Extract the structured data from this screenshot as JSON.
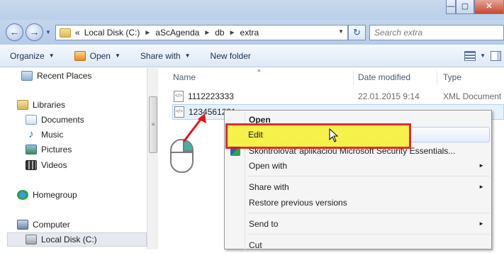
{
  "window": {
    "controls": {
      "minimize": "—",
      "maximize": "▢",
      "close": "✕"
    }
  },
  "address": {
    "back_icon": "←",
    "forward_icon": "→",
    "chevron": "«",
    "crumbs": [
      "Local Disk (C:)",
      "aScAgenda",
      "db",
      "extra"
    ],
    "search_placeholder": "Search extra",
    "refresh_icon": "↻"
  },
  "toolbar": {
    "organize": "Organize",
    "open": "Open",
    "share_with": "Share with",
    "new_folder": "New folder"
  },
  "navpane": {
    "items": [
      {
        "label": "Recent Places",
        "icon": "recent-places-icon"
      },
      {
        "label": "Libraries",
        "icon": "libraries-icon"
      },
      {
        "label": "Documents",
        "icon": "documents-icon"
      },
      {
        "label": "Music",
        "icon": "music-icon"
      },
      {
        "label": "Pictures",
        "icon": "pictures-icon"
      },
      {
        "label": "Videos",
        "icon": "videos-icon"
      },
      {
        "label": "Homegroup",
        "icon": "homegroup-icon"
      },
      {
        "label": "Computer",
        "icon": "computer-icon"
      },
      {
        "label": "Local Disk (C:)",
        "icon": "local-disk-icon"
      }
    ]
  },
  "filelist": {
    "columns": {
      "name": "Name",
      "date": "Date modified",
      "type": "Type"
    },
    "rows": [
      {
        "name": "1112223333",
        "date": "22.01.2015 9:14",
        "type": "XML Document"
      },
      {
        "name": "1234561231",
        "date": "",
        "type": ""
      }
    ]
  },
  "context_menu": {
    "items": [
      {
        "label": "Open",
        "bold": true
      },
      {
        "label": "Edit"
      },
      {
        "label": "Skontrolovať aplikáciou Microsoft Security Essentials..."
      },
      {
        "label": "Open with",
        "submenu": true
      },
      {
        "label": "Share with",
        "submenu": true
      },
      {
        "label": "Restore previous versions"
      },
      {
        "label": "Send to",
        "submenu": true
      },
      {
        "label": "Cut"
      }
    ],
    "submenu_arrow": "►"
  },
  "colors": {
    "highlight_fill": "#f7f238",
    "highlight_border": "#e0161f",
    "mouse_button": "#3bb3a6"
  }
}
